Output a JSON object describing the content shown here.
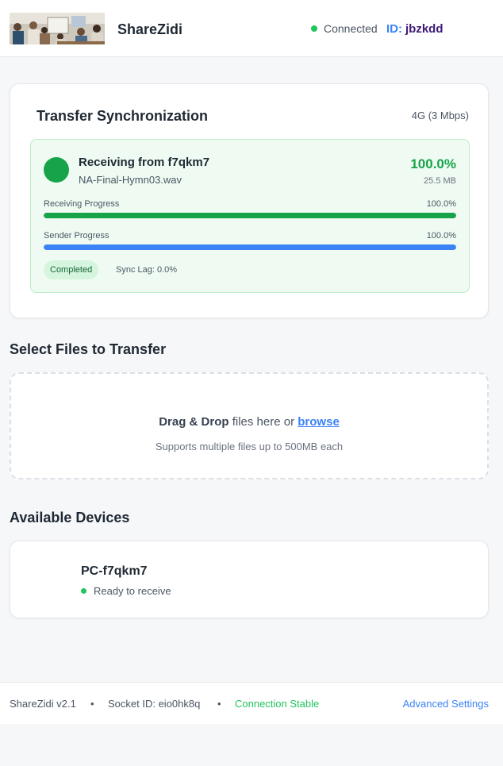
{
  "header": {
    "app_name": "ShareZidi",
    "connection_status": "Connected",
    "id_label": "ID:",
    "id_value": "jbzkdd"
  },
  "sync": {
    "title": "Transfer Synchronization",
    "network": "4G (3 Mbps)",
    "receiving_title": "Receiving from f7qkm7",
    "file_name": "NA-Final-Hymn03.wav",
    "percent": "100.0%",
    "file_size": "25.5 MB",
    "receiving_label": "Receiving Progress",
    "receiving_value": "100.0%",
    "receiving_fraction": 1.0,
    "sender_label": "Sender Progress",
    "sender_value": "100.0%",
    "sender_fraction": 1.0,
    "status_badge": "Completed",
    "sync_lag": "Sync Lag: 0.0%",
    "colors": {
      "receiving": "#16a34a",
      "sender": "#3b82f6"
    }
  },
  "upload": {
    "title": "Select Files to Transfer",
    "drag_strong": "Drag & Drop",
    "drag_text": " files here or ",
    "browse_link": "browse",
    "subtext": "Supports multiple files up to 500MB each"
  },
  "devices": {
    "title": "Available Devices",
    "items": [
      {
        "name": "PC-f7qkm7",
        "status": "Ready to receive"
      }
    ]
  },
  "footer": {
    "version": "ShareZidi v2.1",
    "separator": "•",
    "socket_id": "Socket ID: eio0hk8q",
    "connection": "Connection Stable",
    "advanced": "Advanced Settings"
  }
}
